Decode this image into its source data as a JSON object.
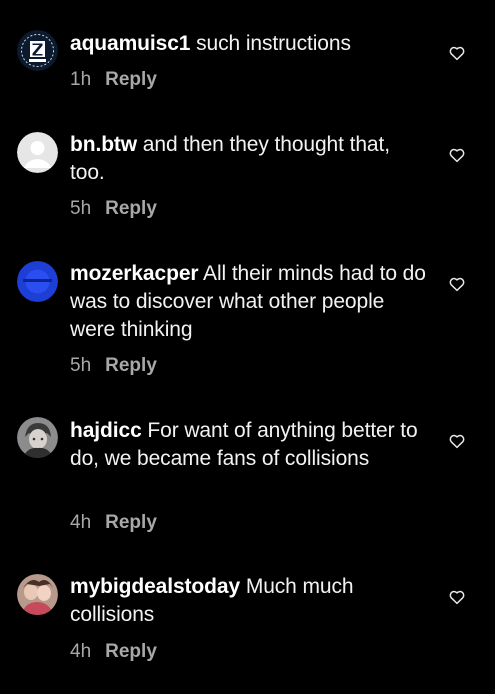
{
  "comments": [
    {
      "username": "aquamuisc1",
      "text": "such instructions",
      "time": "1h",
      "reply_label": "Reply",
      "avatar": "z-logo-avatar"
    },
    {
      "username": "bn.btw",
      "text": "and then they thought that, too.",
      "time": "5h",
      "reply_label": "Reply",
      "avatar": "default-grey-avatar"
    },
    {
      "username": "mozerkacper",
      "text": "All their minds had to do was to discover what other people were thinking",
      "time": "5h",
      "reply_label": "Reply",
      "avatar": "blue-avatar"
    },
    {
      "username": "hajdicc",
      "text": "For want of anything better to do, we became fans of collisions",
      "time": "4h",
      "reply_label": "Reply",
      "avatar": "anime-avatar"
    },
    {
      "username": "mybigdealstoday",
      "text": "Much much collisions",
      "time": "4h",
      "reply_label": "Reply",
      "avatar": "photo-avatar"
    }
  ],
  "icons": {
    "like": "heart-outline-icon"
  },
  "colors": {
    "background": "#000000",
    "text": "#f2f2f2",
    "meta": "#a8a8a8"
  }
}
